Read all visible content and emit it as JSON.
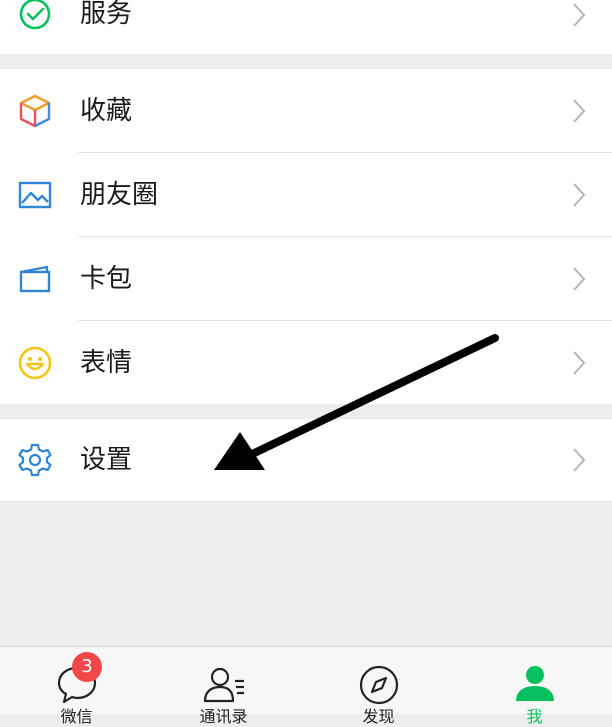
{
  "menu": {
    "services_label": "服务",
    "favorites_label": "收藏",
    "moments_label": "朋友圈",
    "cards_label": "卡包",
    "stickers_label": "表情",
    "settings_label": "设置"
  },
  "tabbar": {
    "chats_label": "微信",
    "chats_badge": "3",
    "contacts_label": "通讯录",
    "discover_label": "发现",
    "me_label": "我"
  },
  "colors": {
    "accent_green": "#07c160",
    "badge_red": "#f04848",
    "icon_blue": "#2f86d6",
    "icon_yellow": "#f5c518"
  }
}
